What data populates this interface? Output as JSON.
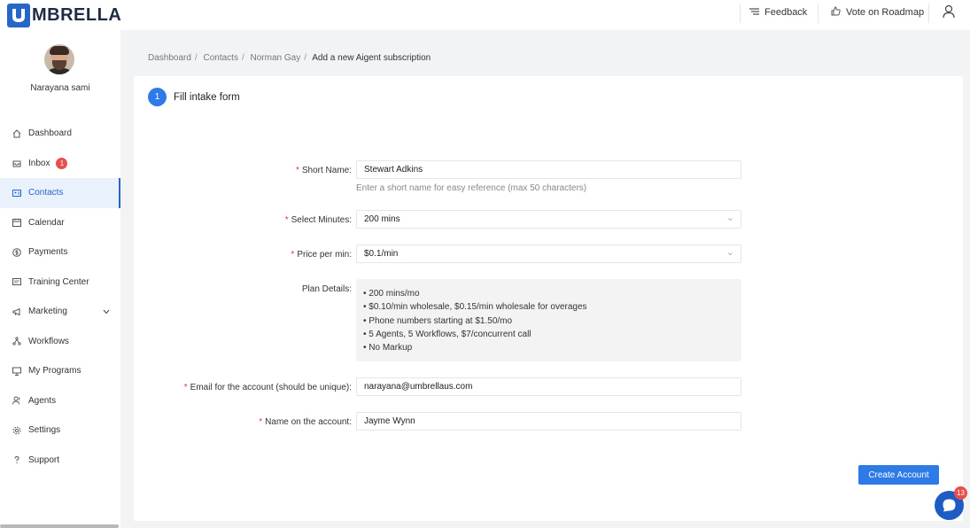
{
  "brand": {
    "logo_text": "MBRELLA",
    "accent": "#2566c8"
  },
  "topbar": {
    "feedback_label": "Feedback",
    "feedback_icon": "list-filter-icon",
    "roadmap_label": "Vote on Roadmap",
    "roadmap_icon": "thumbs-up-icon",
    "user_icon": "user-icon"
  },
  "sidebar": {
    "user_name": "Narayana sami",
    "items": [
      {
        "label": "Dashboard",
        "icon": "home-icon"
      },
      {
        "label": "Inbox",
        "icon": "inbox-icon",
        "badge": "1"
      },
      {
        "label": "Contacts",
        "icon": "contacts-icon",
        "active": true
      },
      {
        "label": "Calendar",
        "icon": "calendar-icon"
      },
      {
        "label": "Payments",
        "icon": "payments-icon"
      },
      {
        "label": "Training Center",
        "icon": "training-icon"
      },
      {
        "label": "Marketing",
        "icon": "megaphone-icon",
        "expandable": true
      },
      {
        "label": "Workflows",
        "icon": "workflow-icon"
      },
      {
        "label": "My Programs",
        "icon": "monitor-icon"
      },
      {
        "label": "Agents",
        "icon": "agents-icon"
      },
      {
        "label": "Settings",
        "icon": "gear-icon"
      },
      {
        "label": "Support",
        "icon": "help-icon"
      }
    ]
  },
  "breadcrumb": [
    "Dashboard",
    "Contacts",
    "Norman Gay",
    "Add a new Aigent subscription"
  ],
  "form": {
    "step_number": "1",
    "step_label": "Fill intake form",
    "short_name": {
      "label": "Short Name:",
      "value": "Stewart Adkins",
      "hint": "Enter a short name for easy reference (max 50 characters)"
    },
    "select_minutes": {
      "label": "Select Minutes:",
      "value": "200 mins"
    },
    "price_per_min": {
      "label": "Price per min:",
      "value": "$0.1/min"
    },
    "plan_details": {
      "label": "Plan Details:",
      "items": [
        "200 mins/mo",
        "$0.10/min wholesale, $0.15/min wholesale for overages",
        "Phone numbers starting at $1.50/mo",
        "5 Agents, 5 Workflows, $7/concurrent call",
        "No Markup"
      ]
    },
    "email": {
      "label": "Email for the account (should be unique):",
      "value": "narayana@umbrellaus.com"
    },
    "account_name": {
      "label": "Name on the account:",
      "value": "Jayme Wynn"
    },
    "required_mark": "*",
    "submit_label": "Create Account"
  },
  "chat": {
    "badge": "13",
    "icon": "chat-icon"
  }
}
